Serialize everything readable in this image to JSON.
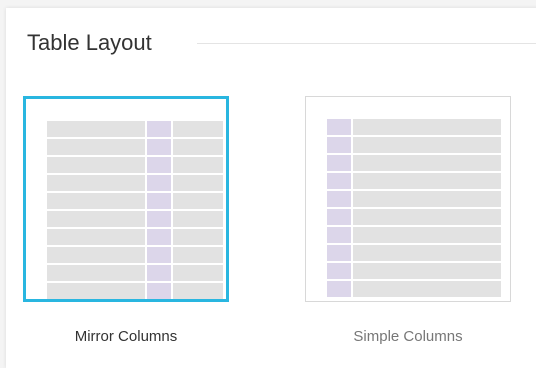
{
  "section": {
    "title": "Table Layout"
  },
  "layout_options": [
    {
      "label": "Mirror Columns",
      "selected": true,
      "thumbnail": "mirror-columns-icon"
    },
    {
      "label": "Simple Columns",
      "selected": false,
      "thumbnail": "simple-columns-icon"
    }
  ],
  "colors": {
    "selected_border": "#29b6e0",
    "row_fill": "#e2e2e2",
    "accent_column": "#dcd6ea",
    "rule": "#e4e4e4"
  }
}
